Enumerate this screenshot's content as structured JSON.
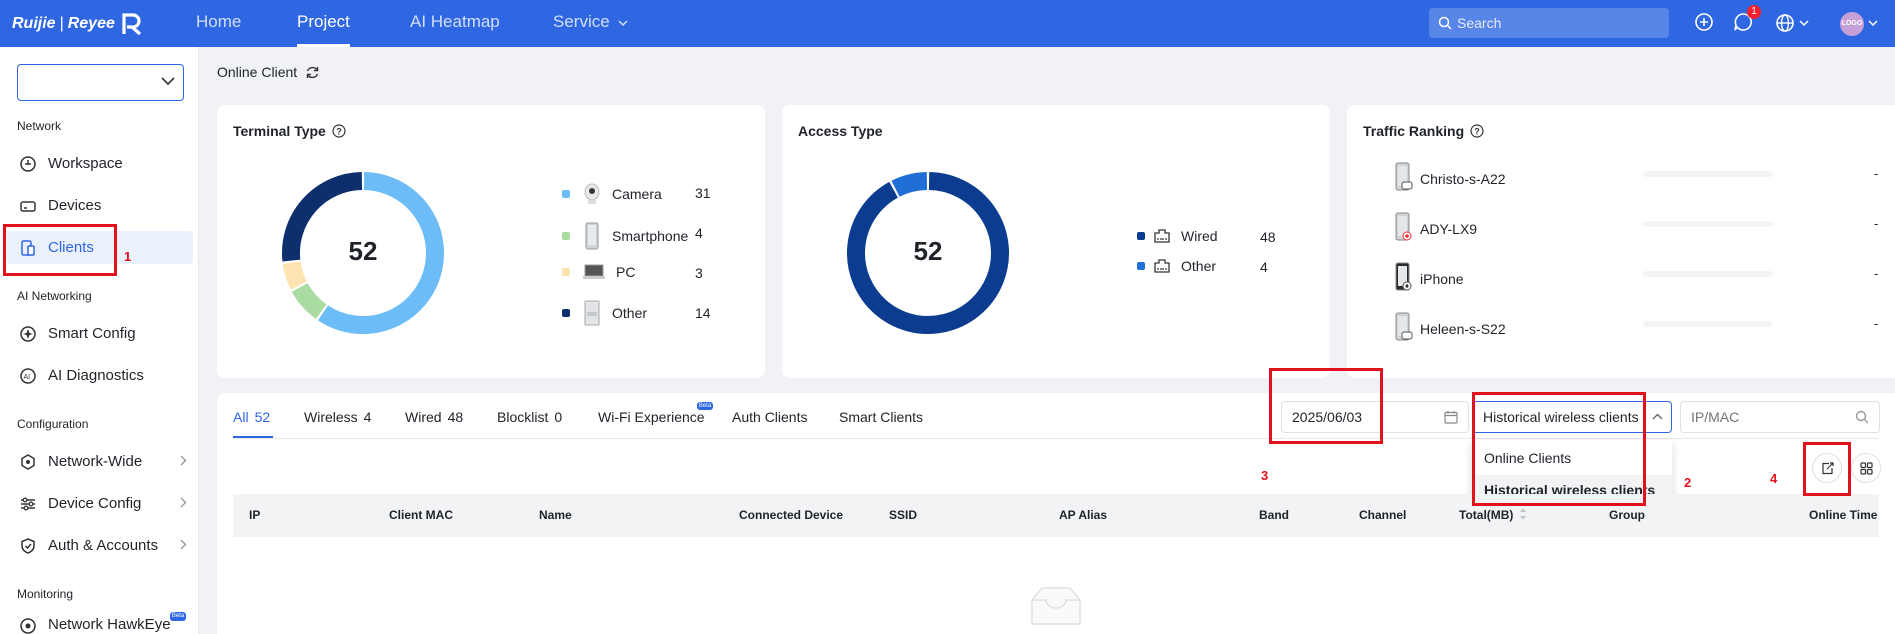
{
  "topbar": {
    "brand": {
      "left": "Ruijie",
      "right": "Reyee"
    },
    "nav": [
      {
        "label": "Home",
        "active": false
      },
      {
        "label": "Project",
        "active": true
      },
      {
        "label": "AI Heatmap",
        "active": false
      },
      {
        "label": "Service",
        "active": false
      }
    ],
    "search_placeholder": "Search",
    "notification_count": "1",
    "avatar_text": "LOGO"
  },
  "sidebar": {
    "groups": {
      "network": "Network",
      "ai_networking": "AI Networking",
      "configuration": "Configuration",
      "monitoring": "Monitoring"
    },
    "items": {
      "workspace": "Workspace",
      "devices": "Devices",
      "clients": "Clients",
      "smart_config": "Smart Config",
      "ai_diagnostics": "AI Diagnostics",
      "network_wide": "Network-Wide",
      "device_config": "Device Config",
      "auth_accounts": "Auth & Accounts",
      "network_hawkeye": "Network HawkEye"
    },
    "beta": "Beta"
  },
  "page": {
    "title": "Online Client"
  },
  "terminal_type": {
    "title": "Terminal Type",
    "total": "52",
    "items": [
      {
        "label": "Camera",
        "count": "31",
        "color": "#6cbcf7"
      },
      {
        "label": "Smartphone",
        "count": "4",
        "color": "#a9dca0"
      },
      {
        "label": "PC",
        "count": "3",
        "color": "#fde3b0"
      },
      {
        "label": "Other",
        "count": "14",
        "color": "#0d2f6e"
      }
    ]
  },
  "access_type": {
    "title": "Access Type",
    "total": "52",
    "items": [
      {
        "label": "Wired",
        "count": "48",
        "color": "#0b3c8f"
      },
      {
        "label": "Other",
        "count": "4",
        "color": "#1f6fd6"
      }
    ]
  },
  "traffic_ranking": {
    "title": "Traffic Ranking",
    "items": [
      {
        "name": "Christo-s-A22",
        "value": "-"
      },
      {
        "name": "ADY-LX9",
        "value": "-"
      },
      {
        "name": "iPhone",
        "value": "-"
      },
      {
        "name": "Heleen-s-S22",
        "value": "-"
      }
    ]
  },
  "tabs": [
    {
      "label": "All",
      "count": "52"
    },
    {
      "label": "Wireless",
      "count": "4"
    },
    {
      "label": "Wired",
      "count": "48"
    },
    {
      "label": "Blocklist",
      "count": "0"
    },
    {
      "label": "Wi-Fi Experience",
      "count": ""
    },
    {
      "label": "Auth Clients",
      "count": ""
    },
    {
      "label": "Smart Clients",
      "count": ""
    }
  ],
  "tab_beta": "Beta",
  "filters": {
    "date": "2025/06/03",
    "mode_selected": "Historical wireless clients",
    "mode_options": [
      "Online Clients",
      "Historical wireless clients"
    ],
    "ipmac_placeholder": "IP/MAC"
  },
  "table": {
    "columns": [
      "IP",
      "Client MAC",
      "Name",
      "Connected Device",
      "SSID",
      "AP Alias",
      "Band",
      "Channel",
      "Total(MB)",
      "Group",
      "Online Time"
    ]
  },
  "annotations": [
    "1",
    "2",
    "3",
    "4"
  ],
  "colors": {
    "brand_blue": "#2f67e3",
    "annotation_red": "#e3101d"
  }
}
